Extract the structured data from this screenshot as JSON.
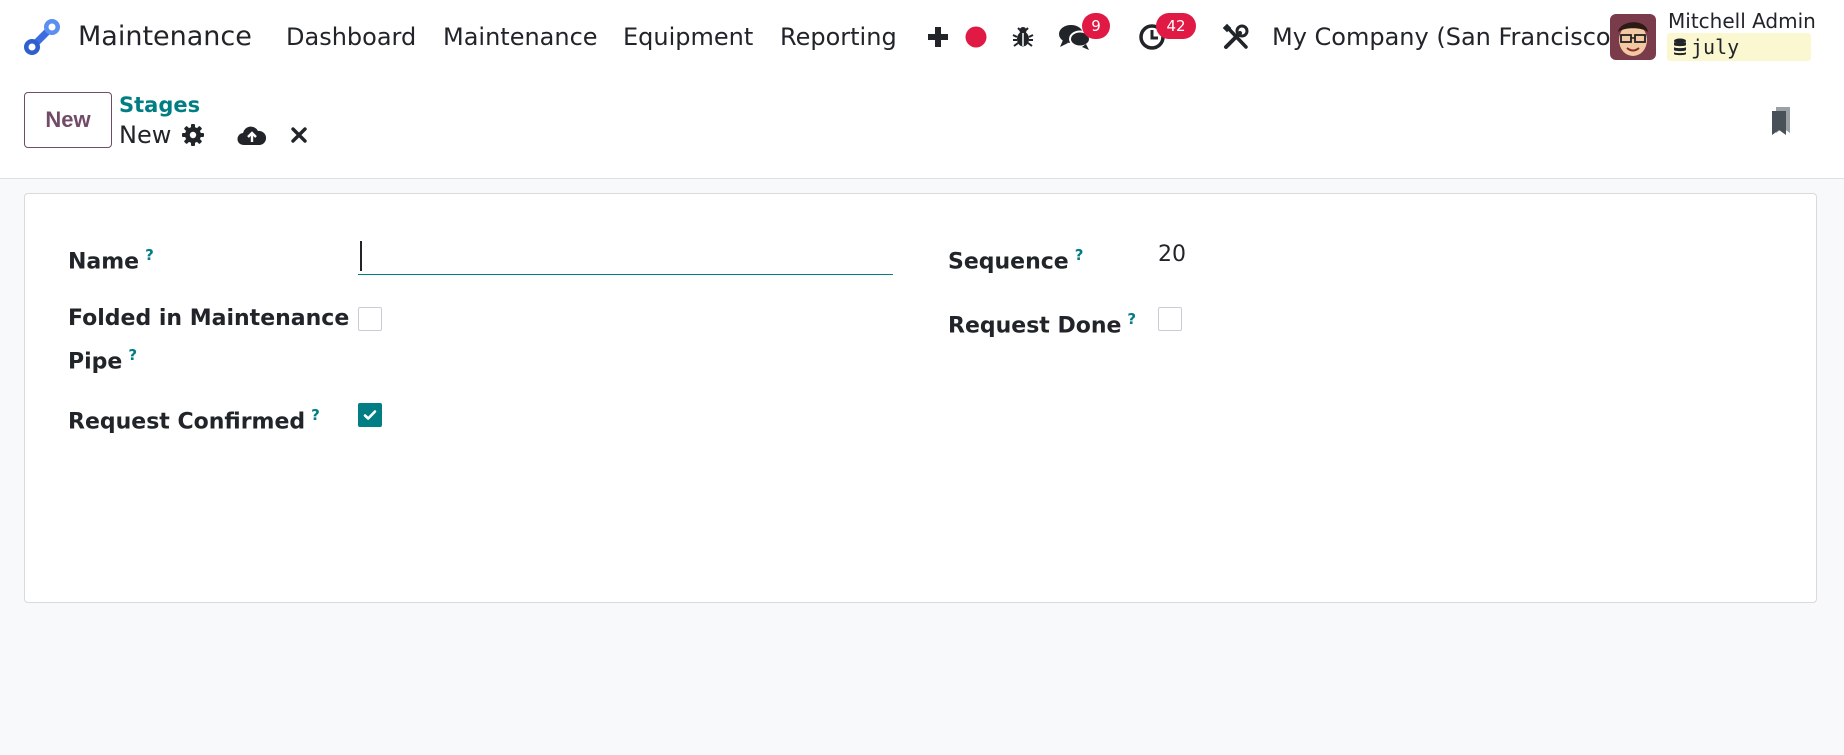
{
  "navbar": {
    "app_name": "Maintenance",
    "menu": [
      "Dashboard",
      "Maintenance",
      "Equipment",
      "Reporting"
    ],
    "messages_badge": "9",
    "activities_badge": "42",
    "company": "My Company (San Francisco)",
    "user_name": "Mitchell Admin",
    "database": "july",
    "icons": [
      "app-logo-icon",
      "plus-icon",
      "record-dot-icon",
      "bug-icon",
      "chat-icon",
      "clock-icon",
      "tools-icon",
      "database-icon"
    ]
  },
  "control": {
    "new_button": "New",
    "breadcrumb_parent": "Stages",
    "breadcrumb_current": "New",
    "icons": [
      "gear-icon",
      "cloud-upload-icon",
      "close-icon",
      "bookmark-icon"
    ]
  },
  "form": {
    "name_label": "Name",
    "name_value": "",
    "sequence_label": "Sequence",
    "sequence_value": "20",
    "folded_label_line1": "Folded in Maintenance",
    "folded_label_line2": "Pipe",
    "folded_checked": false,
    "request_done_label": "Request Done",
    "request_done_checked": false,
    "request_confirmed_label": "Request Confirmed",
    "request_confirmed_checked": true,
    "tooltip_mark": "?"
  },
  "colors": {
    "accent": "#017e84",
    "brand": "#714b67",
    "badge": "#e01a44",
    "db_chip": "#fbf7d0"
  }
}
